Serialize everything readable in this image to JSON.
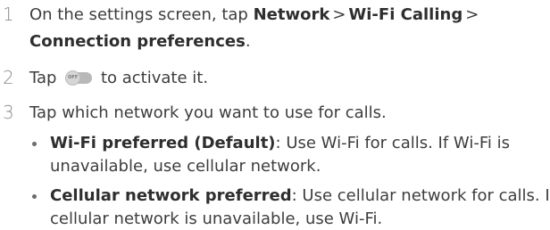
{
  "steps": [
    {
      "number": "1",
      "prefix": "On the settings screen, tap ",
      "path1": "Network",
      "sep1": ">",
      "path2": "Wi-Fi Calling",
      "sep2": ">",
      "path3": "Connection preferences",
      "suffix": "."
    },
    {
      "number": "2",
      "before": "Tap",
      "toggle_icon": "toggle-switch-off-icon",
      "toggle_label": "OFF",
      "after": "to activate it."
    },
    {
      "number": "3",
      "text": "Tap which network you want to use for calls."
    }
  ],
  "options": [
    {
      "label": "Wi-Fi preferred (Default)",
      "line1": ": Use Wi-Fi for calls. If Wi-Fi is",
      "line2": "unavailable, use cellular network."
    },
    {
      "label": "Cellular network preferred",
      "line1": ": Use cellular network for calls. If",
      "line2": "cellular network is unavailable, use Wi-Fi."
    }
  ]
}
